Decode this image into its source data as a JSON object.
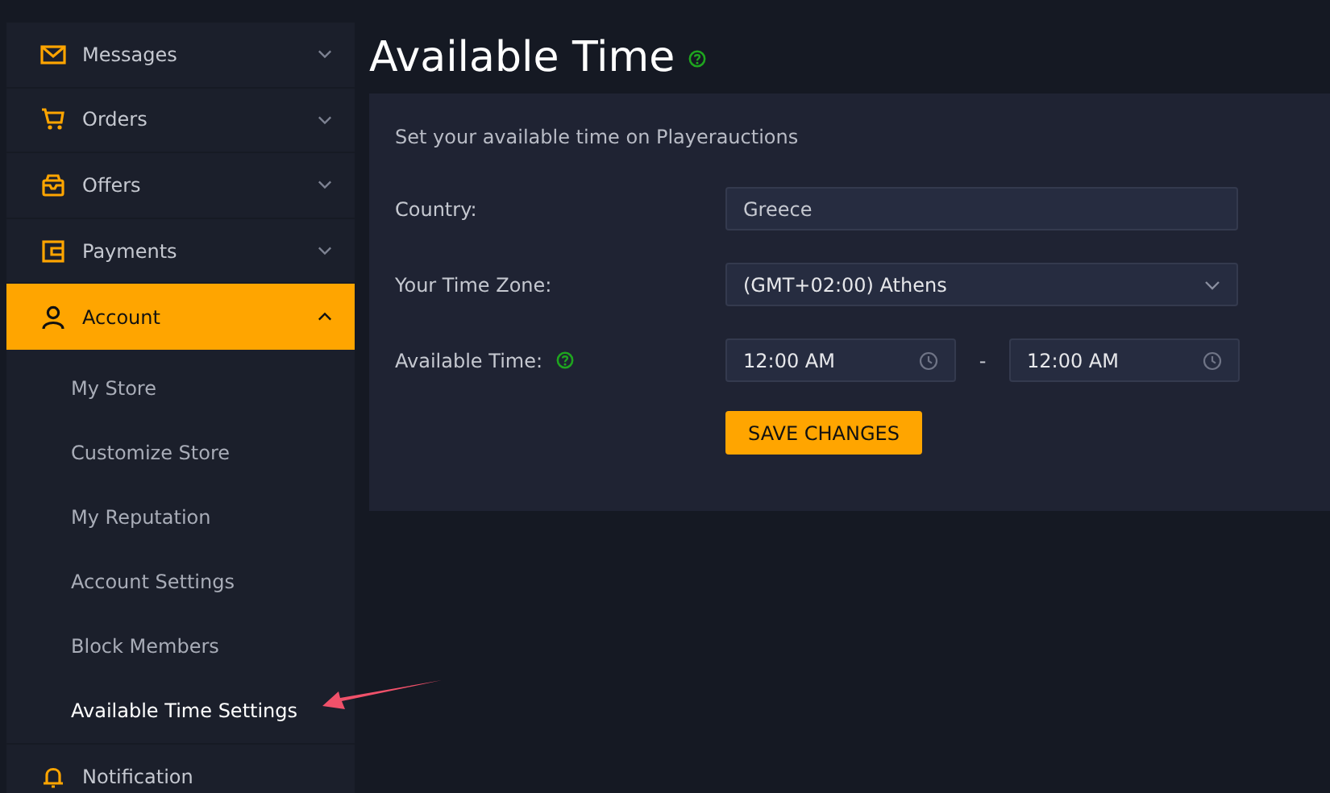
{
  "sidebar": {
    "items": [
      {
        "label": "Messages",
        "selected": false,
        "expanded": false
      },
      {
        "label": "Orders",
        "selected": false,
        "expanded": false
      },
      {
        "label": "Offers",
        "selected": false,
        "expanded": false
      },
      {
        "label": "Payments",
        "selected": false,
        "expanded": false
      },
      {
        "label": "Account",
        "selected": true,
        "expanded": true,
        "children": [
          {
            "label": "My Store",
            "selected": false
          },
          {
            "label": "Customize Store",
            "selected": false
          },
          {
            "label": "My Reputation",
            "selected": false
          },
          {
            "label": "Account Settings",
            "selected": false
          },
          {
            "label": "Block Members",
            "selected": false
          },
          {
            "label": "Available Time Settings",
            "selected": true
          }
        ]
      },
      {
        "label": "Notification",
        "selected": false
      }
    ]
  },
  "page": {
    "title": "Available Time",
    "intro": "Set your available time on Playerauctions",
    "fields": [
      {
        "kind": "text",
        "label": "Country:",
        "value": "Greece"
      },
      {
        "kind": "select",
        "label": "Your Time Zone:",
        "value": "(GMT+02:00) Athens"
      },
      {
        "kind": "time-range",
        "label": "Available Time:",
        "from": "12:00 AM",
        "separator": "-",
        "to": "12:00 AM"
      }
    ],
    "button": "SAVE CHANGES"
  }
}
